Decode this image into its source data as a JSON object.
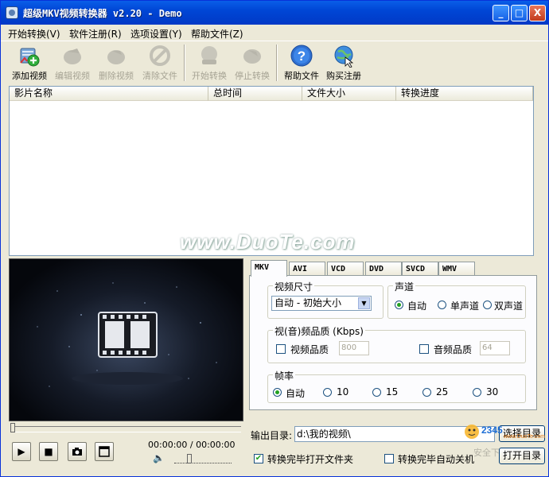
{
  "window": {
    "title": "超级MKV视频转换器 v2.20 - Demo",
    "controls": {
      "minimize": "_",
      "maximize": "□",
      "close": "X"
    }
  },
  "menu": [
    "开始转换(V)",
    "软件注册(R)",
    "选项设置(Y)",
    "帮助文件(Z)"
  ],
  "toolbar": {
    "add_video": "添加视频",
    "edit_video": "编辑视频",
    "delete_video": "删除视频",
    "clear_files": "清除文件",
    "start_convert": "开始转换",
    "stop_convert": "停止转换",
    "help_file": "帮助文件",
    "buy_register": "购买注册"
  },
  "file_list": {
    "columns": [
      "影片名称",
      "总时间",
      "文件大小",
      "转换进度"
    ],
    "rows": []
  },
  "watermark": "www.DuoTe.com",
  "player": {
    "time": "00:00:00 / 00:00:00",
    "play_icon": "play-icon",
    "stop_icon": "stop-icon",
    "snapshot_icon": "camera-icon",
    "fullscreen_icon": "window-icon",
    "speaker_icon": "speaker-icon"
  },
  "format_tabs": [
    "MKV",
    "AVI",
    "VCD",
    "DVD",
    "SVCD",
    "WMV"
  ],
  "settings": {
    "video_size": {
      "title": "视频尺寸",
      "value": "自动 - 初始大小"
    },
    "channel": {
      "title": "声道",
      "options": [
        "自动",
        "单声道",
        "双声道"
      ],
      "selected": "自动"
    },
    "quality": {
      "title": "视(音)频品质 (Kbps)",
      "video_label": "视频品质",
      "video_value": "800",
      "audio_label": "音频品质",
      "audio_value": "64"
    },
    "framerate": {
      "title": "帧率",
      "options": [
        "自动",
        "10",
        "15",
        "25",
        "30"
      ],
      "selected": "自动"
    }
  },
  "output": {
    "label": "输出目录:",
    "path": "d:\\我的视频\\",
    "choose_button": "选择目录",
    "open_button": "打开目录"
  },
  "options": {
    "open_folder_after": "转换完毕打开文件夹",
    "open_folder_after_checked": true,
    "shutdown_after": "转换完毕自动关机",
    "shutdown_after_checked": false
  },
  "badge": {
    "brand": "2345",
    "site": "www.DuoTe.com",
    "tagline": "安全下载"
  }
}
